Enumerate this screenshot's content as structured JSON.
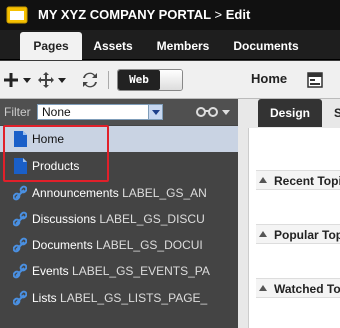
{
  "title": {
    "app": "MY XYZ COMPANY PORTAL",
    "separator": ">",
    "mode": "Edit"
  },
  "tabs": [
    {
      "label": "Pages",
      "active": true
    },
    {
      "label": "Assets",
      "active": false
    },
    {
      "label": "Members",
      "active": false
    },
    {
      "label": "Documents",
      "active": false
    }
  ],
  "toolbar": {
    "add_icon": "plus-icon",
    "move_icon": "move-arrows-icon",
    "refresh_icon": "refresh-icon",
    "view_toggle_label": "Web",
    "breadcrumb": "Home",
    "page_icon": "page-layout-icon"
  },
  "filter": {
    "label": "Filter",
    "selected": "None"
  },
  "tree": [
    {
      "type": "page",
      "icon": "page-icon",
      "label": "Home",
      "suffix": ""
    },
    {
      "type": "page",
      "icon": "page-icon",
      "label": "Products",
      "suffix": ""
    },
    {
      "type": "link",
      "icon": "link-icon",
      "label": "Announcements",
      "suffix": "LABEL_GS_AN"
    },
    {
      "type": "link",
      "icon": "link-icon",
      "label": "Discussions",
      "suffix": "LABEL_GS_DISCU"
    },
    {
      "type": "link",
      "icon": "link-icon",
      "label": "Documents",
      "suffix": "LABEL_GS_DOCUI"
    },
    {
      "type": "link",
      "icon": "link-icon",
      "label": "Events",
      "suffix": "LABEL_GS_EVENTS_PA"
    },
    {
      "type": "link",
      "icon": "link-icon",
      "label": "Lists",
      "suffix": "LABEL_GS_LISTS_PAGE_"
    }
  ],
  "right": {
    "tab_design": "Design",
    "tab_next": "S",
    "widgets": [
      "Recent Topi",
      "Popular Top",
      "Watched To"
    ]
  },
  "colors": {
    "highlight": "#e0202a",
    "page_icon": "#1a5fc8",
    "link_icon": "#4a90e2"
  }
}
